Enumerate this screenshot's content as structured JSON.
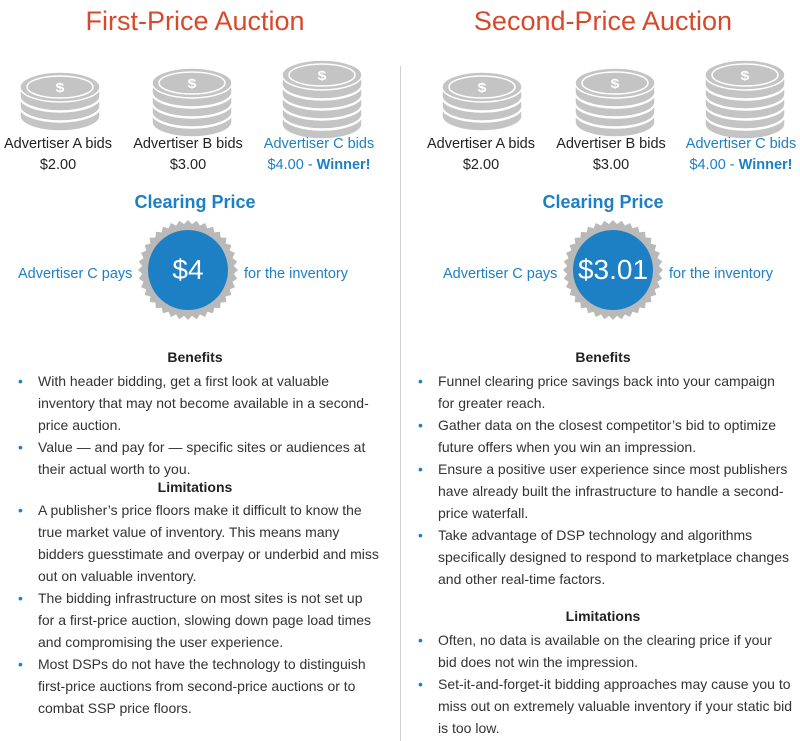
{
  "first": {
    "title": "First-Price Auction",
    "bidders": [
      {
        "name": "Advertiser A bids",
        "amount": "$2.00"
      },
      {
        "name": "Advertiser B bids",
        "amount": "$3.00"
      },
      {
        "name": "Advertiser C bids",
        "amount": "$4.00 - ",
        "winner": "Winner!"
      }
    ],
    "clearing_label": "Clearing Price",
    "pays": "Advertiser C pays",
    "price": "$4",
    "for_inventory": "for the inventory",
    "benefits_heading": "Benefits",
    "benefits": [
      "With header bidding, get a first look at valuable inventory that may not become available in a second-price auction.",
      "Value — and pay for — specific sites or audiences at their actual worth to you."
    ],
    "limitations_heading": "Limitations",
    "limitations": [
      "A publisher’s price floors make it difficult to know the true market value of inventory. This means many bidders guesstimate and overpay or underbid and miss out on valuable inventory.",
      "The bidding infrastructure on most sites is not set up for a first-price auction, slowing down page load times and compromising the user experience.",
      "Most DSPs do not have the technology to distinguish first-price auctions from second-price auctions or to combat SSP price floors."
    ]
  },
  "second": {
    "title": "Second-Price Auction",
    "bidders": [
      {
        "name": "Advertiser A bids",
        "amount": "$2.00"
      },
      {
        "name": "Advertiser B bids",
        "amount": "$3.00"
      },
      {
        "name": "Advertiser C bids",
        "amount": "$4.00 - ",
        "winner": "Winner!"
      }
    ],
    "clearing_label": "Clearing Price",
    "pays": "Advertiser C pays",
    "price": "$3.01",
    "for_inventory": "for the inventory",
    "benefits_heading": "Benefits",
    "benefits": [
      "Funnel clearing price savings back into your campaign for greater reach.",
      "Gather data on the closest competitor’s bid to optimize future offers when you win an impression.",
      "Ensure a positive user experience since most publishers have already built the infrastructure to handle a second-price waterfall.",
      "Take advantage of DSP technology and algorithms specifically designed to respond to marketplace changes and other real-time factors."
    ],
    "limitations_heading": "Limitations",
    "limitations": [
      "Often, no data is available on the clearing price if your bid does not win the impression.",
      "Set-it-and-forget-it bidding approaches may cause you to miss out on extremely valuable inventory if your static bid is too low."
    ]
  },
  "colors": {
    "title": "#d9482b",
    "accent": "#1d7fc4",
    "coin": "#c4c4c4",
    "seal_ring": "#b9b9b9"
  },
  "icons": {
    "coin": "coin-stack-icon",
    "seal": "price-seal-icon",
    "bullet": "bullet-icon"
  }
}
